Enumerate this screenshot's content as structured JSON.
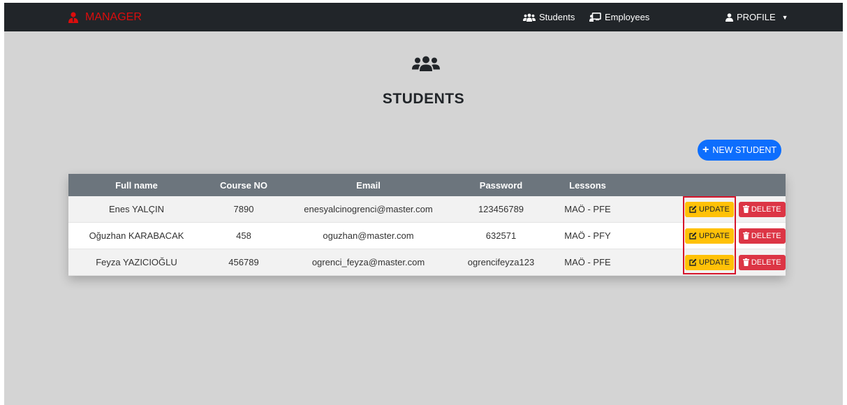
{
  "navbar": {
    "brand": "MANAGER",
    "links": [
      {
        "label": "Students",
        "icon": "users-icon"
      },
      {
        "label": "Employees",
        "icon": "chalkboard-teacher-icon"
      }
    ],
    "profile": "PROFILE"
  },
  "page": {
    "title": "STUDENTS",
    "new_button": "NEW STUDENT"
  },
  "table": {
    "columns": [
      "Full name",
      "Course NO",
      "Email",
      "Password",
      "Lessons",
      ""
    ],
    "rows": [
      {
        "name": "Enes YALÇIN",
        "course_no": "7890",
        "email": "enesyalcinogrenci@master.com",
        "password": "123456789",
        "lessons": "MAÖ - PFE"
      },
      {
        "name": "Oğuzhan KARABACAK",
        "course_no": "458",
        "email": "oguzhan@master.com",
        "password": "632571",
        "lessons": "MAÖ - PFY"
      },
      {
        "name": "Feyza YAZICIOĞLU",
        "course_no": "456789",
        "email": "ogrenci_feyza@master.com",
        "password": "ogrencifeyza123",
        "lessons": "MAÖ - PFE"
      }
    ],
    "update_label": "UPDATE",
    "delete_label": "DELETE"
  },
  "colors": {
    "navbar": "#212529",
    "brand": "#dc0d0d",
    "primary": "#0d6efd",
    "warning": "#ffc107",
    "danger": "#dc3545",
    "table_header": "#6c757d",
    "highlight": "#d6152b"
  }
}
